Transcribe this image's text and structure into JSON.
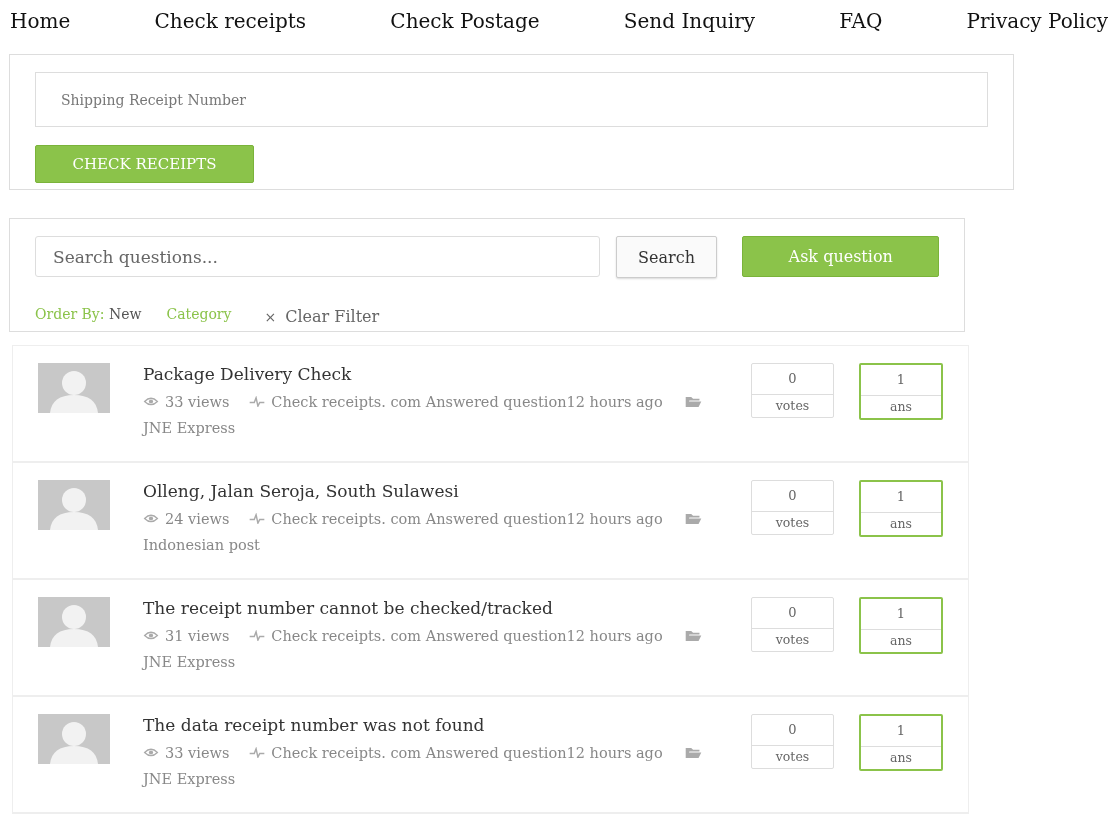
{
  "nav": [
    {
      "label": "Home"
    },
    {
      "label": "Check receipts"
    },
    {
      "label": "Check Postage"
    },
    {
      "label": "Send Inquiry"
    },
    {
      "label": "FAQ"
    },
    {
      "label": "Privacy Policy"
    }
  ],
  "receipt_form": {
    "placeholder": "Shipping Receipt Number",
    "button": "CHECK RECEIPTS"
  },
  "question_search": {
    "placeholder": "Search questions...",
    "search_button": "Search",
    "ask_button": "Ask question",
    "order_by_label": "Order By:",
    "order_by_value": "New",
    "category": "Category",
    "clear_icon": "×",
    "clear_filter": "Clear Filter"
  },
  "questions": [
    {
      "title": "Package Delivery Check",
      "views": "33 views",
      "activity": "Check receipts. com Answered question12 hours ago",
      "category": "JNE Express",
      "votes": "0",
      "votes_label": "votes",
      "answers": "1",
      "answers_label": "ans"
    },
    {
      "title": "Olleng, Jalan Seroja, South Sulawesi",
      "views": "24 views",
      "activity": "Check receipts. com Answered question12 hours ago",
      "category": "Indonesian post",
      "votes": "0",
      "votes_label": "votes",
      "answers": "1",
      "answers_label": "ans"
    },
    {
      "title": "The receipt number cannot be checked/tracked",
      "views": "31 views",
      "activity": "Check receipts. com Answered question12 hours ago",
      "category": "JNE Express",
      "votes": "0",
      "votes_label": "votes",
      "answers": "1",
      "answers_label": "ans"
    },
    {
      "title": "The data receipt number was not found",
      "views": "33 views",
      "activity": "Check receipts. com Answered question12 hours ago",
      "category": "JNE Express",
      "votes": "0",
      "votes_label": "votes",
      "answers": "1",
      "answers_label": "ans"
    }
  ]
}
